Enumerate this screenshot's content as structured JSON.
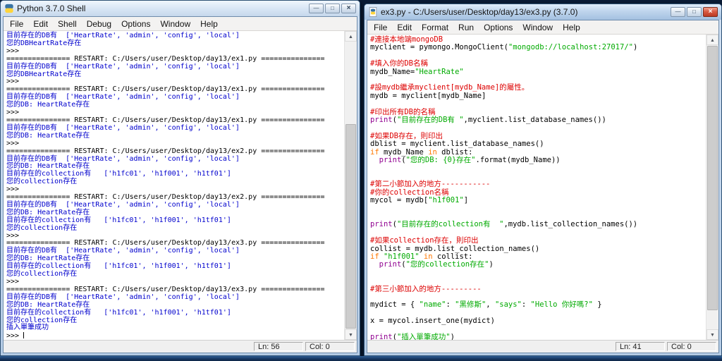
{
  "colors": {
    "stdout": "#0000cd",
    "console": "#000000",
    "comment": "#dd0000",
    "string": "#00aa00",
    "keyword": "#ff7700",
    "builtin": "#900090",
    "titlebar_active": "#a4c1e1",
    "titlebar_inactive": "#dbe8f6",
    "close_button_red": "#bc3a23",
    "taskbar_blue": "#16355e"
  },
  "window_controls": {
    "minimize_glyph": "—",
    "maximize_glyph": "□",
    "close_glyph": "×"
  },
  "icons": {
    "arrow_up": "▲",
    "arrow_down": "▼"
  },
  "shell_window": {
    "title": "Python 3.7.0 Shell",
    "menus": [
      "File",
      "Edit",
      "Shell",
      "Debug",
      "Options",
      "Window",
      "Help"
    ],
    "status": {
      "line": "Ln: 56",
      "col": "Col: 0"
    },
    "lines": [
      {
        "s": [
          {
            "t": "目前存在的DB有  ['HeartRate', 'admin', 'config', 'local']",
            "c": "out"
          }
        ]
      },
      {
        "s": [
          {
            "t": "您的DBHeartRate存在",
            "c": "out"
          }
        ]
      },
      {
        "s": [
          {
            "t": ">>> ",
            "c": "con"
          }
        ]
      },
      {
        "s": [
          {
            "t": "=============== RESTART: C:/Users/user/Desktop/day13/ex1.py ===============",
            "c": "con"
          }
        ]
      },
      {
        "s": [
          {
            "t": "目前存在的DB有  ['HeartRate', 'admin', 'config', 'local']",
            "c": "out"
          }
        ]
      },
      {
        "s": [
          {
            "t": "您的DBHeartRate存在",
            "c": "out"
          }
        ]
      },
      {
        "s": [
          {
            "t": ">>> ",
            "c": "con"
          }
        ]
      },
      {
        "s": [
          {
            "t": "=============== RESTART: C:/Users/user/Desktop/day13/ex1.py ===============",
            "c": "con"
          }
        ]
      },
      {
        "s": [
          {
            "t": "目前存在的DB有  ['HeartRate', 'admin', 'config', 'local']",
            "c": "out"
          }
        ]
      },
      {
        "s": [
          {
            "t": "您的DB: HeartRate存在",
            "c": "out"
          }
        ]
      },
      {
        "s": [
          {
            "t": ">>> ",
            "c": "con"
          }
        ]
      },
      {
        "s": [
          {
            "t": "=============== RESTART: C:/Users/user/Desktop/day13/ex1.py ===============",
            "c": "con"
          }
        ]
      },
      {
        "s": [
          {
            "t": "目前存在的DB有  ['HeartRate', 'admin', 'config', 'local']",
            "c": "out"
          }
        ]
      },
      {
        "s": [
          {
            "t": "您的DB: HeartRate存在",
            "c": "out"
          }
        ]
      },
      {
        "s": [
          {
            "t": ">>> ",
            "c": "con"
          }
        ]
      },
      {
        "s": [
          {
            "t": "=============== RESTART: C:/Users/user/Desktop/day13/ex2.py ===============",
            "c": "con"
          }
        ]
      },
      {
        "s": [
          {
            "t": "目前存在的DB有  ['HeartRate', 'admin', 'config', 'local']",
            "c": "out"
          }
        ]
      },
      {
        "s": [
          {
            "t": "您的DB: HeartRate存在",
            "c": "out"
          }
        ]
      },
      {
        "s": [
          {
            "t": "目前存在的collection有   ['h1fc01', 'h1f001', 'h1tf01']",
            "c": "out"
          }
        ]
      },
      {
        "s": [
          {
            "t": "您的collection存在",
            "c": "out"
          }
        ]
      },
      {
        "s": [
          {
            "t": ">>> ",
            "c": "con"
          }
        ]
      },
      {
        "s": [
          {
            "t": "=============== RESTART: C:/Users/user/Desktop/day13/ex2.py ===============",
            "c": "con"
          }
        ]
      },
      {
        "s": [
          {
            "t": "目前存在的DB有  ['HeartRate', 'admin', 'config', 'local']",
            "c": "out"
          }
        ]
      },
      {
        "s": [
          {
            "t": "您的DB: HeartRate存在",
            "c": "out"
          }
        ]
      },
      {
        "s": [
          {
            "t": "目前存在的collection有   ['h1fc01', 'h1f001', 'h1tf01']",
            "c": "out"
          }
        ]
      },
      {
        "s": [
          {
            "t": "您的collection存在",
            "c": "out"
          }
        ]
      },
      {
        "s": [
          {
            "t": ">>> ",
            "c": "con"
          }
        ]
      },
      {
        "s": [
          {
            "t": "=============== RESTART: C:/Users/user/Desktop/day13/ex3.py ===============",
            "c": "con"
          }
        ]
      },
      {
        "s": [
          {
            "t": "目前存在的DB有  ['HeartRate', 'admin', 'config', 'local']",
            "c": "out"
          }
        ]
      },
      {
        "s": [
          {
            "t": "您的DB: HeartRate存在",
            "c": "out"
          }
        ]
      },
      {
        "s": [
          {
            "t": "目前存在的collection有   ['h1fc01', 'h1f001', 'h1tf01']",
            "c": "out"
          }
        ]
      },
      {
        "s": [
          {
            "t": "您的collection存在",
            "c": "out"
          }
        ]
      },
      {
        "s": [
          {
            "t": ">>> ",
            "c": "con"
          }
        ]
      },
      {
        "s": [
          {
            "t": "=============== RESTART: C:/Users/user/Desktop/day13/ex3.py ===============",
            "c": "con"
          }
        ]
      },
      {
        "s": [
          {
            "t": "目前存在的DB有  ['HeartRate', 'admin', 'config', 'local']",
            "c": "out"
          }
        ]
      },
      {
        "s": [
          {
            "t": "您的DB: HeartRate存在",
            "c": "out"
          }
        ]
      },
      {
        "s": [
          {
            "t": "目前存在的collection有   ['h1fc01', 'h1f001', 'h1tf01']",
            "c": "out"
          }
        ]
      },
      {
        "s": [
          {
            "t": "您的collection存在",
            "c": "out"
          }
        ]
      },
      {
        "s": [
          {
            "t": "插入單筆成功",
            "c": "out"
          }
        ]
      },
      {
        "s": [
          {
            "t": ">>> ",
            "c": "con"
          }
        ]
      }
    ]
  },
  "editor_window": {
    "title": "ex3.py - C:/Users/user/Desktop/day13/ex3.py (3.7.0)",
    "menus": [
      "File",
      "Edit",
      "Format",
      "Run",
      "Options",
      "Window",
      "Help"
    ],
    "status": {
      "line": "Ln: 41",
      "col": "Col: 0"
    },
    "lines": [
      {
        "s": [
          {
            "t": "#連接本地端mongoDB",
            "c": "com"
          }
        ]
      },
      {
        "s": [
          {
            "t": "myclient = pymongo.MongoClient(",
            "c": "pln"
          },
          {
            "t": "\"mongodb://localhost:27017/\"",
            "c": "str"
          },
          {
            "t": ")",
            "c": "pln"
          }
        ]
      },
      {
        "s": []
      },
      {
        "s": [
          {
            "t": "#填入你的DB名稱",
            "c": "com"
          }
        ]
      },
      {
        "s": [
          {
            "t": "mydb_Name=",
            "c": "pln"
          },
          {
            "t": "\"HeartRate\"",
            "c": "str"
          }
        ]
      },
      {
        "s": []
      },
      {
        "s": [
          {
            "t": "#設mydb繼承myclient[mydb_Name]的屬性。",
            "c": "com"
          }
        ]
      },
      {
        "s": [
          {
            "t": "mydb = myclient[mydb_Name]",
            "c": "pln"
          }
        ]
      },
      {
        "s": []
      },
      {
        "s": [
          {
            "t": "#印出所有DB的名稱",
            "c": "com"
          }
        ]
      },
      {
        "s": [
          {
            "t": "print",
            "c": "blt"
          },
          {
            "t": "(",
            "c": "pln"
          },
          {
            "t": "\"目前存在的DB有 \"",
            "c": "str"
          },
          {
            "t": ",myclient.list_database_names())",
            "c": "pln"
          }
        ]
      },
      {
        "s": []
      },
      {
        "s": [
          {
            "t": "#如果DB存在，則印出",
            "c": "com"
          }
        ]
      },
      {
        "s": [
          {
            "t": "dblist = myclient.list_database_names()",
            "c": "pln"
          }
        ]
      },
      {
        "s": [
          {
            "t": "if",
            "c": "kw"
          },
          {
            "t": " mydb_Name ",
            "c": "pln"
          },
          {
            "t": "in",
            "c": "kw"
          },
          {
            "t": " dblist:",
            "c": "pln"
          }
        ]
      },
      {
        "s": [
          {
            "t": "  ",
            "c": "pln"
          },
          {
            "t": "print",
            "c": "blt"
          },
          {
            "t": "(",
            "c": "pln"
          },
          {
            "t": "\"您的DB: {0}存在\"",
            "c": "str"
          },
          {
            "t": ".format(mydb_Name))",
            "c": "pln"
          }
        ]
      },
      {
        "s": []
      },
      {
        "s": []
      },
      {
        "s": [
          {
            "t": "#第二小節加入的地方-----------",
            "c": "com"
          }
        ]
      },
      {
        "s": [
          {
            "t": "#你的collection名稱",
            "c": "com"
          }
        ]
      },
      {
        "s": [
          {
            "t": "mycol = mydb[",
            "c": "pln"
          },
          {
            "t": "\"h1f001\"",
            "c": "str"
          },
          {
            "t": "]",
            "c": "pln"
          }
        ]
      },
      {
        "s": []
      },
      {
        "s": []
      },
      {
        "s": [
          {
            "t": "print",
            "c": "blt"
          },
          {
            "t": "(",
            "c": "pln"
          },
          {
            "t": "\"目前存在的collection有  \"",
            "c": "str"
          },
          {
            "t": ",mydb.list_collection_names())",
            "c": "pln"
          }
        ]
      },
      {
        "s": []
      },
      {
        "s": [
          {
            "t": "#如果collection存在，則印出",
            "c": "com"
          }
        ]
      },
      {
        "s": [
          {
            "t": "collist = mydb.list_collection_names()",
            "c": "pln"
          }
        ]
      },
      {
        "s": [
          {
            "t": "if",
            "c": "kw"
          },
          {
            "t": " ",
            "c": "pln"
          },
          {
            "t": "\"h1f001\"",
            "c": "str"
          },
          {
            "t": " ",
            "c": "pln"
          },
          {
            "t": "in",
            "c": "kw"
          },
          {
            "t": " collist:",
            "c": "pln"
          }
        ]
      },
      {
        "s": [
          {
            "t": "  ",
            "c": "pln"
          },
          {
            "t": "print",
            "c": "blt"
          },
          {
            "t": "(",
            "c": "pln"
          },
          {
            "t": "\"您的collection存在\"",
            "c": "str"
          },
          {
            "t": ")",
            "c": "pln"
          }
        ]
      },
      {
        "s": []
      },
      {
        "s": []
      },
      {
        "s": [
          {
            "t": "#第三小節加入的地方---------",
            "c": "com"
          }
        ]
      },
      {
        "s": []
      },
      {
        "s": [
          {
            "t": "mydict = { ",
            "c": "pln"
          },
          {
            "t": "\"name\"",
            "c": "str"
          },
          {
            "t": ": ",
            "c": "pln"
          },
          {
            "t": "\"黑修斯\"",
            "c": "str"
          },
          {
            "t": ", ",
            "c": "pln"
          },
          {
            "t": "\"says\"",
            "c": "str"
          },
          {
            "t": ": ",
            "c": "pln"
          },
          {
            "t": "\"Hello 你好嗎?\"",
            "c": "str"
          },
          {
            "t": " }",
            "c": "pln"
          }
        ]
      },
      {
        "s": []
      },
      {
        "s": [
          {
            "t": "x = mycol.insert_one(mydict)",
            "c": "pln"
          }
        ]
      },
      {
        "s": []
      },
      {
        "s": [
          {
            "t": "print",
            "c": "blt"
          },
          {
            "t": "(",
            "c": "pln"
          },
          {
            "t": "\"插入單筆成功\"",
            "c": "str"
          },
          {
            "t": ")",
            "c": "pln"
          }
        ]
      }
    ]
  }
}
